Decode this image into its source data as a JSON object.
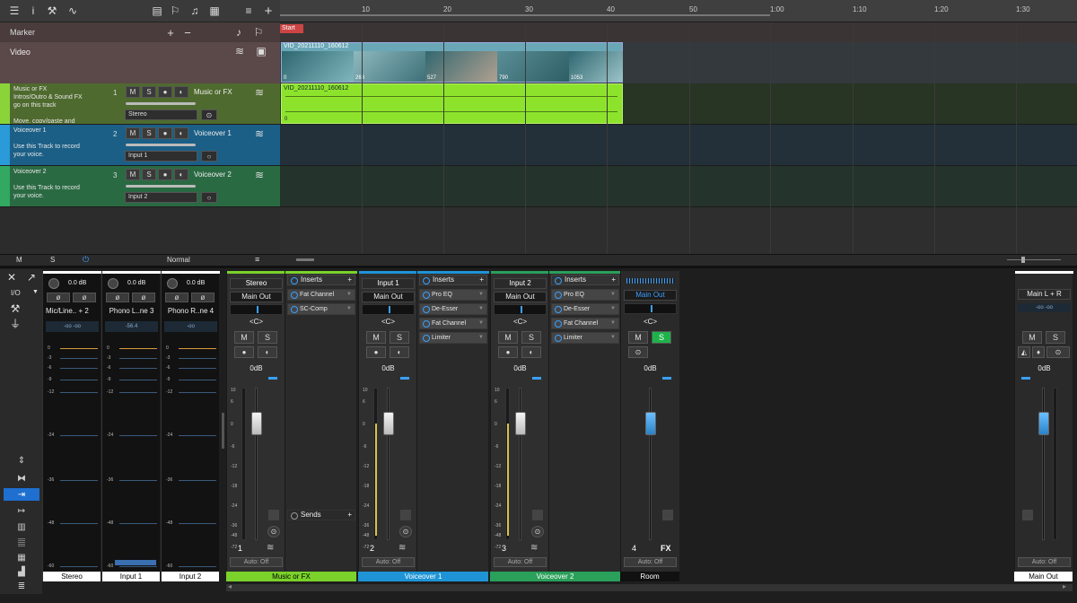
{
  "ruler": {
    "ticks": [
      "10",
      "20",
      "30",
      "40",
      "50",
      "1:00",
      "1:10",
      "1:20",
      "1:30"
    ]
  },
  "marker": {
    "label": "Marker",
    "start": "Start"
  },
  "video": {
    "label": "Video",
    "clip": "VID_20211110_160612",
    "frames": [
      "0",
      "263",
      "527",
      "790",
      "1053"
    ]
  },
  "tracks": [
    {
      "num": "1",
      "name": "Music or FX",
      "desc": "Music or FX\nIntros/Outro & Sound FX\ngo on this track\n\nMove, copy/paste and",
      "input": "Stereo",
      "color": "#5a8a2a",
      "lane": "#283424"
    },
    {
      "num": "2",
      "name": "Voiceover 1",
      "desc": "Voiceover 1\n\nUse this Track to record\nyour voice.",
      "input": "Input 1",
      "color": "#1b6f9c",
      "lane": "#233039"
    },
    {
      "num": "3",
      "name": "Voiceover 2",
      "desc": "Voiceover 2\n\nUse this Track to record\nyour voice.",
      "input": "Input 2",
      "color": "#2f7f4a",
      "lane": "#24332b"
    }
  ],
  "audio_clip": {
    "name": "VID_20211110_160612",
    "zero": "0"
  },
  "arrange_footer": {
    "m": "M",
    "s": "S",
    "mode": "Normal"
  },
  "mixer": {
    "io_label": "I/O",
    "small_channels": [
      {
        "name": "Mic/Line.. + 2",
        "val": "0.0 dB",
        "label": "Stereo",
        "sub": "-oo -oo"
      },
      {
        "name": "Phono L..ne 3",
        "val": "0.0 dB",
        "label": "Input 1",
        "sub": "-56.4"
      },
      {
        "name": "Phono R..ne 4",
        "val": "0.0 dB",
        "label": "Input 2",
        "sub": "-oo"
      }
    ],
    "scale_small": [
      "0",
      "-3",
      "-6",
      "-9",
      "-12",
      "-24",
      "-36",
      "-48",
      "-60"
    ],
    "scale_big": [
      "10",
      "6",
      "0",
      "-6",
      "-12",
      "-18",
      "-24",
      "-36",
      "-48",
      "-72"
    ],
    "channels": [
      {
        "name": "Stereo",
        "out": "Main Out",
        "pan": "<C>",
        "db": "0dB",
        "num": "1",
        "auto": "Auto: Off",
        "label": "Music or FX",
        "labelcolor": "#7ad22a",
        "m": "M",
        "s": "S",
        "inserts_title": "Inserts",
        "inserts": [
          "Fat Channel",
          "SC-Comp"
        ],
        "sends": "Sends"
      },
      {
        "name": "Input 1",
        "out": "Main Out",
        "pan": "<C>",
        "db": "0dB",
        "num": "2",
        "auto": "Auto: Off",
        "label": "Voiceover 1",
        "labelcolor": "#1e94d6",
        "m": "M",
        "s": "S",
        "inserts_title": "Inserts",
        "inserts": [
          "Pro EQ",
          "De-Esser",
          "Fat Channel",
          "Limiter"
        ]
      },
      {
        "name": "Input 2",
        "out": "Main Out",
        "pan": "<C>",
        "db": "0dB",
        "num": "3",
        "auto": "Auto: Off",
        "label": "Voiceover 2",
        "labelcolor": "#2aa05a",
        "m": "M",
        "s": "S",
        "inserts_title": "Inserts",
        "inserts": [
          "Pro EQ",
          "De-Esser",
          "Fat Channel",
          "Limiter"
        ]
      }
    ],
    "fx": {
      "out": "Main Out",
      "pan": "<C>",
      "db": "0dB",
      "num": "4",
      "tag": "FX",
      "auto": "Auto: Off",
      "label": "Room",
      "m": "M",
      "s": "S"
    },
    "main": {
      "name": "Main L + R",
      "db": "0dB",
      "auto": "Auto: Off",
      "label": "Main Out",
      "m": "M",
      "s": "S"
    }
  }
}
